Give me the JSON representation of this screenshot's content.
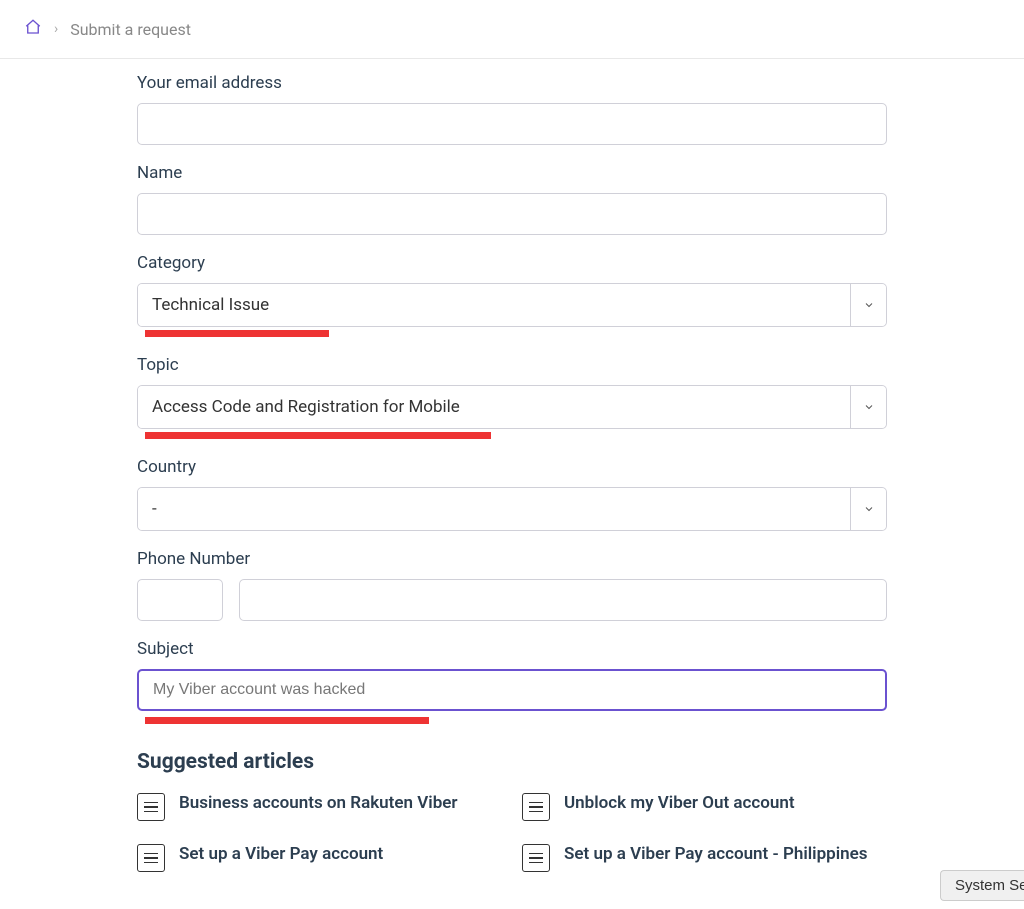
{
  "breadcrumb": {
    "current": "Submit a request"
  },
  "form": {
    "email_label": "Your email address",
    "email_value": "",
    "name_label": "Name",
    "name_value": "",
    "category_label": "Category",
    "category_value": "Technical Issue",
    "topic_label": "Topic",
    "topic_value": "Access Code and Registration for Mobile",
    "country_label": "Country",
    "country_value": "-",
    "phone_label": "Phone Number",
    "subject_label": "Subject",
    "subject_value": "My Viber account was hacked"
  },
  "suggested": {
    "heading": "Suggested articles",
    "items": [
      "Business accounts on Rakuten Viber",
      "Unblock my Viber Out account",
      "Set up a Viber Pay account",
      "Set up a Viber Pay account - Philippines"
    ]
  },
  "system_button_label": "System Se"
}
